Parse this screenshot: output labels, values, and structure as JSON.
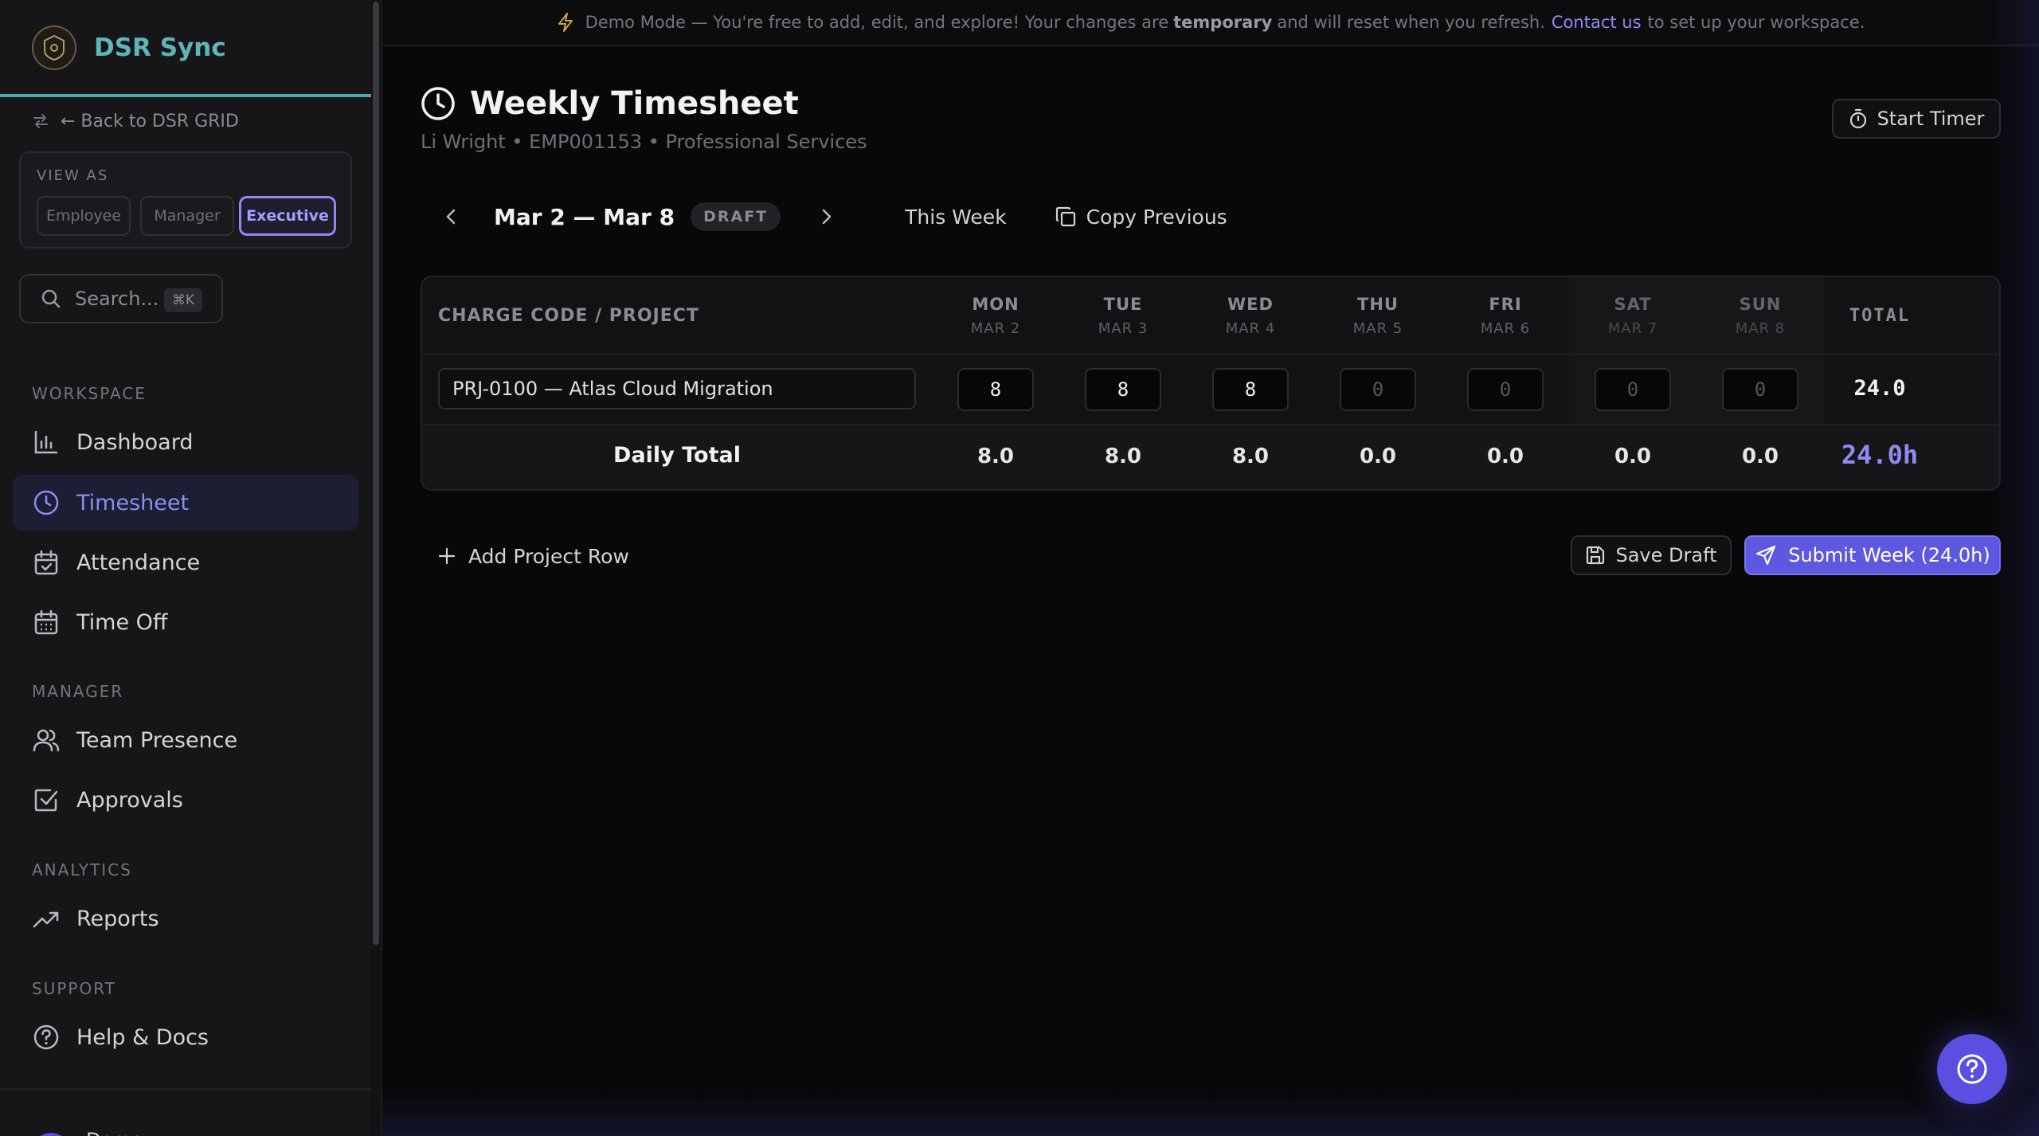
{
  "brand": {
    "name": "DSR Sync"
  },
  "sidebar": {
    "back_link": "← Back to DSR GRID",
    "view_as": {
      "label": "VIEW AS",
      "options": [
        "Employee",
        "Manager",
        "Executive"
      ],
      "selected": "Executive"
    },
    "search": {
      "placeholder": "Search...",
      "shortcut": "⌘K"
    },
    "sections": [
      {
        "label": "WORKSPACE",
        "items": [
          {
            "label": "Dashboard",
            "icon": "bar-chart-icon"
          },
          {
            "label": "Timesheet",
            "icon": "clock-icon",
            "active": true
          },
          {
            "label": "Attendance",
            "icon": "calendar-check-icon"
          },
          {
            "label": "Time Off",
            "icon": "calendar-icon"
          }
        ]
      },
      {
        "label": "MANAGER",
        "items": [
          {
            "label": "Team Presence",
            "icon": "users-icon"
          },
          {
            "label": "Approvals",
            "icon": "check-square-icon"
          }
        ]
      },
      {
        "label": "ANALYTICS",
        "items": [
          {
            "label": "Reports",
            "icon": "trending-up-icon"
          }
        ]
      },
      {
        "label": "SUPPORT",
        "items": [
          {
            "label": "Help & Docs",
            "icon": "help-circle-icon"
          }
        ]
      }
    ],
    "user": {
      "name": "Demo ..."
    }
  },
  "banner": {
    "prefix": "Demo Mode — You're free to add, edit, and explore! Your changes are",
    "bold": "temporary",
    "middle": "and will reset when you refresh.",
    "link": "Contact us",
    "suffix": "to set up your workspace."
  },
  "page": {
    "title": "Weekly Timesheet",
    "subtitle": "Li Wright • EMP001153 • Professional Services",
    "start_timer": "Start Timer"
  },
  "week": {
    "range": "Mar 2 — Mar 8",
    "status": "DRAFT",
    "this_week": "This Week",
    "copy_previous": "Copy Previous"
  },
  "grid": {
    "project_header": "CHARGE CODE / PROJECT",
    "total_header": "TOTAL",
    "days": [
      {
        "day": "MON",
        "date": "MAR 2"
      },
      {
        "day": "TUE",
        "date": "MAR 3"
      },
      {
        "day": "WED",
        "date": "MAR 4"
      },
      {
        "day": "THU",
        "date": "MAR 5"
      },
      {
        "day": "FRI",
        "date": "MAR 6"
      },
      {
        "day": "SAT",
        "date": "MAR 7"
      },
      {
        "day": "SUN",
        "date": "MAR 8"
      }
    ],
    "rows": [
      {
        "project": "PRJ-0100 — Atlas Cloud Migration",
        "hours": [
          "8",
          "8",
          "8",
          "0",
          "0",
          "0",
          "0"
        ],
        "total": "24.0"
      }
    ],
    "daily_total_label": "Daily Total",
    "daily_totals": [
      "8.0",
      "8.0",
      "8.0",
      "0.0",
      "0.0",
      "0.0",
      "0.0"
    ],
    "grand_total": "24.0h"
  },
  "actions": {
    "add_row": "Add Project Row",
    "save_draft": "Save Draft",
    "submit": "Submit Week (24.0h)"
  },
  "colors": {
    "accent": "#5e57e0",
    "brand": "#5eb6b8"
  }
}
